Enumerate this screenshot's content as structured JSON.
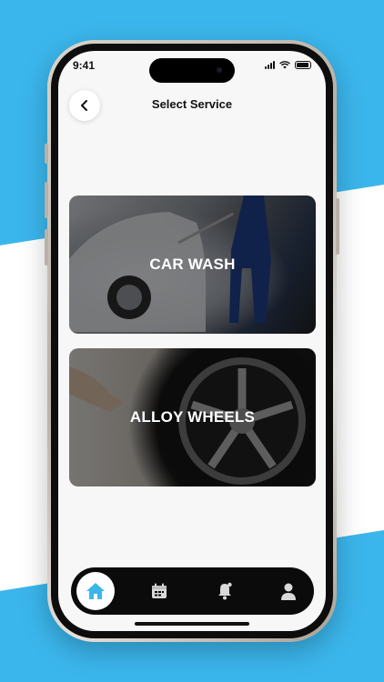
{
  "status_bar": {
    "time": "9:41"
  },
  "header": {
    "title": "Select Service",
    "back_icon": "chevron-left-icon"
  },
  "services": [
    {
      "label": "CAR WASH"
    },
    {
      "label": "ALLOY WHEELS"
    }
  ],
  "bottom_nav": {
    "items": [
      {
        "icon": "home-icon",
        "active": true
      },
      {
        "icon": "calendar-icon",
        "active": false
      },
      {
        "icon": "bell-icon",
        "active": false
      },
      {
        "icon": "user-icon",
        "active": false
      }
    ]
  },
  "colors": {
    "accent": "#3bb6ec",
    "nav_bg": "#0b0b0b",
    "screen_bg": "#f7f7f7"
  }
}
